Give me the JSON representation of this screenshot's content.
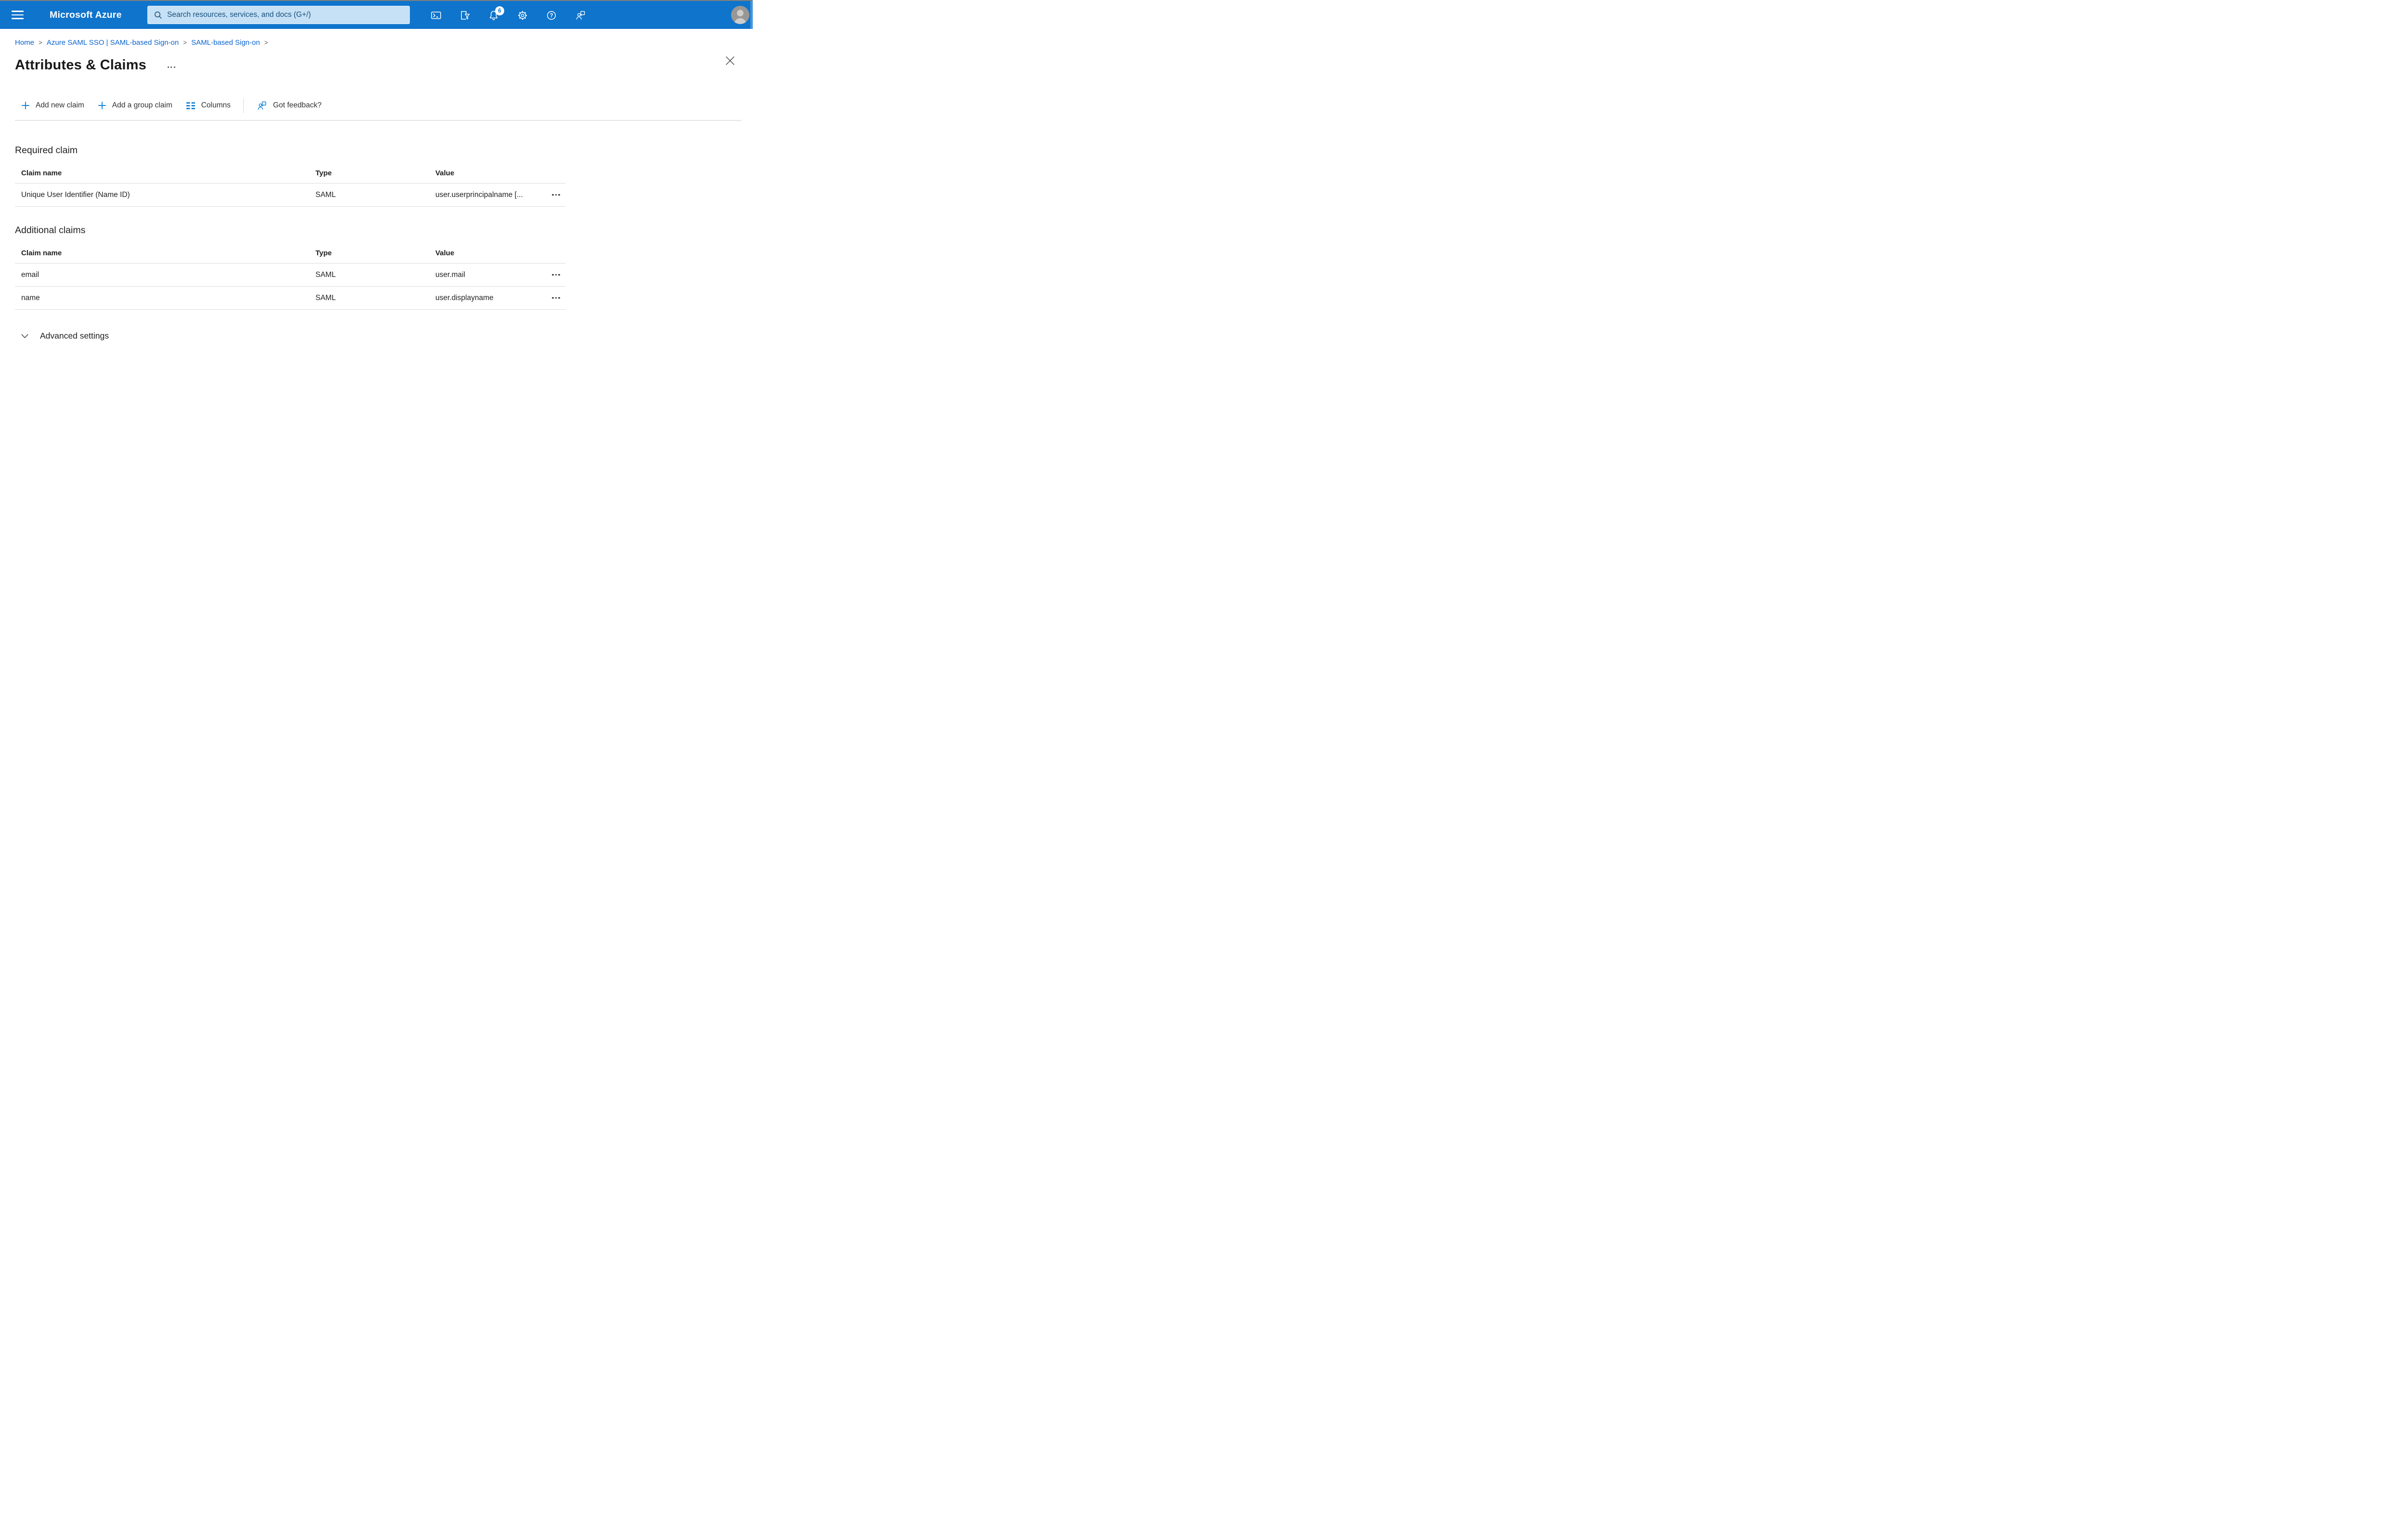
{
  "colors": {
    "header_bg": "#0E74CC",
    "accent": "#0078D4",
    "link": "#0A63CE",
    "search_bg": "#C6E0F5",
    "search_text": "#17517E",
    "text_primary": "#201F1E",
    "text_muted": "#605E5C",
    "divider": "#DDDBD9"
  },
  "header": {
    "product_name": "Microsoft Azure",
    "search": {
      "placeholder": "Search resources, services, and docs (G+/)"
    },
    "notification_badge": "6"
  },
  "breadcrumb": {
    "separator": ">",
    "items": [
      {
        "label": "Home"
      },
      {
        "label": "Azure SAML SSO | SAML-based Sign-on"
      },
      {
        "label": "SAML-based Sign-on"
      }
    ]
  },
  "page": {
    "title": "Attributes & Claims"
  },
  "toolbar": {
    "add_new_claim": "Add new claim",
    "add_group_claim": "Add a group claim",
    "columns": "Columns",
    "got_feedback": "Got feedback?"
  },
  "required_claim": {
    "heading": "Required claim",
    "columns": {
      "name": "Claim name",
      "type": "Type",
      "value": "Value"
    },
    "rows": [
      {
        "name": "Unique User Identifier (Name ID)",
        "type": "SAML",
        "value": "user.userprincipalname [..."
      }
    ]
  },
  "additional_claims": {
    "heading": "Additional claims",
    "columns": {
      "name": "Claim name",
      "type": "Type",
      "value": "Value"
    },
    "rows": [
      {
        "name": "email",
        "type": "SAML",
        "value": "user.mail"
      },
      {
        "name": "name",
        "type": "SAML",
        "value": "user.displayname"
      }
    ]
  },
  "advanced_settings": {
    "label": "Advanced settings"
  }
}
